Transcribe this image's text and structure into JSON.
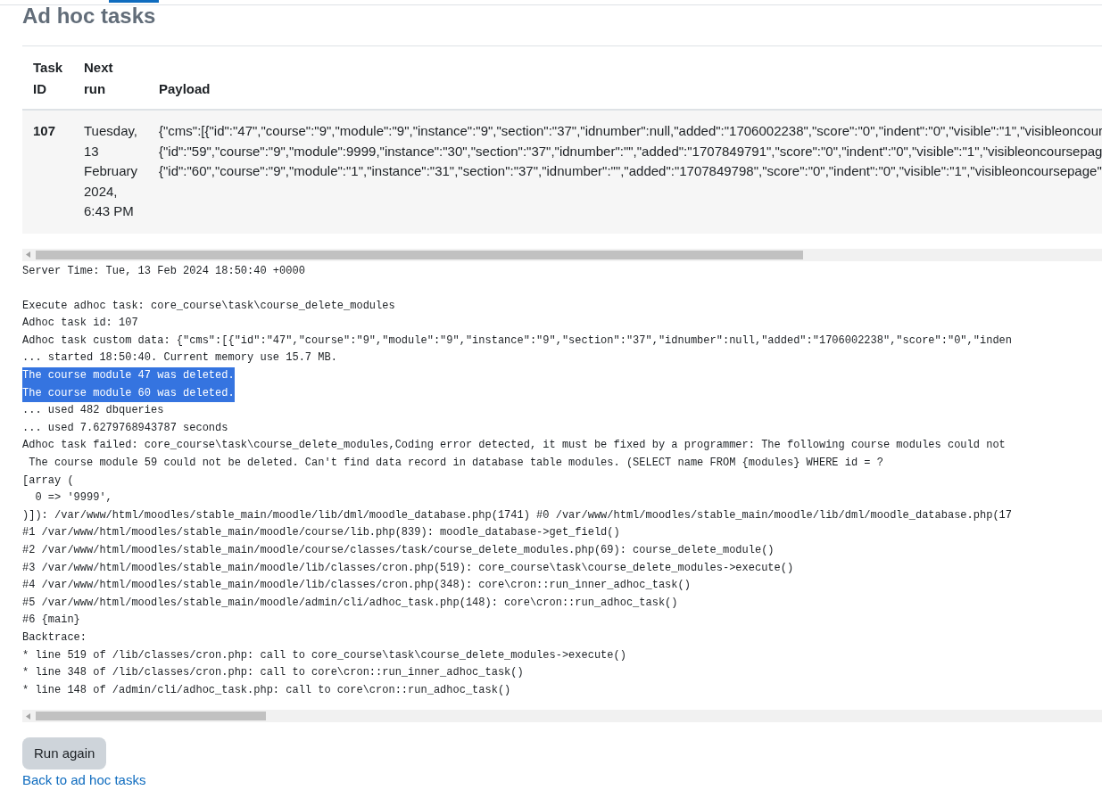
{
  "page": {
    "title": "Ad hoc tasks"
  },
  "table": {
    "columns": [
      "Task ID",
      "Next run",
      "Payload"
    ],
    "rows": [
      {
        "task_id": "107",
        "next_run": "Tuesday, 13 February 2024, 6:43 PM",
        "payload": [
          "{\"cms\":[{\"id\":\"47\",\"course\":\"9\",\"module\":\"9\",\"instance\":\"9\",\"section\":\"37\",\"idnumber\":null,\"added\":\"1706002238\",\"score\":\"0\",\"indent\":\"0\",\"visible\":\"1\",\"visibleoncour",
          "{\"id\":\"59\",\"course\":\"9\",\"module\":9999,\"instance\":\"30\",\"section\":\"37\",\"idnumber\":\"\",\"added\":\"1707849791\",\"score\":\"0\",\"indent\":\"0\",\"visible\":\"1\",\"visibleoncoursepag",
          "{\"id\":\"60\",\"course\":\"9\",\"module\":\"1\",\"instance\":\"31\",\"section\":\"37\",\"idnumber\":\"\",\"added\":\"1707849798\",\"score\":\"0\",\"indent\":\"0\",\"visible\":\"1\",\"visibleoncoursepage\""
        ]
      }
    ]
  },
  "output": {
    "lines": [
      {
        "text": "Server Time: Tue, 13 Feb 2024 18:50:40 +0000",
        "selected": false
      },
      {
        "text": "Execute adhoc task: core_course\\task\\course_delete_modules",
        "selected": false,
        "gap_before": true
      },
      {
        "text": "Adhoc task id: 107",
        "selected": false
      },
      {
        "text": "Adhoc task custom data: {\"cms\":[{\"id\":\"47\",\"course\":\"9\",\"module\":\"9\",\"instance\":\"9\",\"section\":\"37\",\"idnumber\":null,\"added\":\"1706002238\",\"score\":\"0\",\"inden",
        "selected": false
      },
      {
        "text": "... started 18:50:40. Current memory use 15.7 MB.",
        "selected": false
      },
      {
        "text": "The course module 47 was deleted.",
        "selected": true
      },
      {
        "text": "The course module 60 was deleted.",
        "selected": true
      },
      {
        "text": "... used 482 dbqueries",
        "selected": false
      },
      {
        "text": "... used 7.6279768943787 seconds",
        "selected": false
      },
      {
        "text": "Adhoc task failed: core_course\\task\\course_delete_modules,Coding error detected, it must be fixed by a programmer: The following course modules could not",
        "selected": false
      },
      {
        "text": " The course module 59 could not be deleted. Can't find data record in database table modules. (SELECT name FROM {modules} WHERE id = ?",
        "selected": false
      },
      {
        "text": "[array (",
        "selected": false
      },
      {
        "text": "  0 => '9999',",
        "selected": false
      },
      {
        "text": ")]): /var/www/html/moodles/stable_main/moodle/lib/dml/moodle_database.php(1741) #0 /var/www/html/moodles/stable_main/moodle/lib/dml/moodle_database.php(17",
        "selected": false
      },
      {
        "text": "#1 /var/www/html/moodles/stable_main/moodle/course/lib.php(839): moodle_database->get_field()",
        "selected": false
      },
      {
        "text": "#2 /var/www/html/moodles/stable_main/moodle/course/classes/task/course_delete_modules.php(69): course_delete_module()",
        "selected": false
      },
      {
        "text": "#3 /var/www/html/moodles/stable_main/moodle/lib/classes/cron.php(519): core_course\\task\\course_delete_modules->execute()",
        "selected": false
      },
      {
        "text": "#4 /var/www/html/moodles/stable_main/moodle/lib/classes/cron.php(348): core\\cron::run_inner_adhoc_task()",
        "selected": false
      },
      {
        "text": "#5 /var/www/html/moodles/stable_main/moodle/admin/cli/adhoc_task.php(148): core\\cron::run_adhoc_task()",
        "selected": false
      },
      {
        "text": "#6 {main}",
        "selected": false
      },
      {
        "text": "Backtrace:",
        "selected": false
      },
      {
        "text": "* line 519 of /lib/classes/cron.php: call to core_course\\task\\course_delete_modules->execute()",
        "selected": false
      },
      {
        "text": "* line 348 of /lib/classes/cron.php: call to core\\cron::run_inner_adhoc_task()",
        "selected": false
      },
      {
        "text": "* line 148 of /admin/cli/adhoc_task.php: call to core\\cron::run_adhoc_task()",
        "selected": false
      }
    ]
  },
  "buttons": [
    {
      "label": "Run again"
    }
  ],
  "link": {
    "label": "Back to ad hoc tasks"
  }
}
